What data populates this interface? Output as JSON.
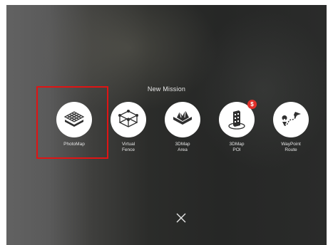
{
  "screen": {
    "title": "New Mission"
  },
  "missions": [
    {
      "label": "PhotoMap",
      "icon": "photomap-icon",
      "selected": true
    },
    {
      "label": "Virtual\nFence",
      "icon": "virtual-fence-icon"
    },
    {
      "label": "3DMap\nArea",
      "icon": "3dmap-area-icon"
    },
    {
      "label": "3DMap\nPOI",
      "icon": "3dmap-poi-icon",
      "badge": "$"
    },
    {
      "label": "WayPoint\nRoute",
      "icon": "waypoint-route-icon"
    }
  ],
  "close": {
    "icon": "close-icon"
  },
  "colors": {
    "highlight": "#e01414",
    "badge": "#e0302a",
    "icon": "#2f2f2f"
  }
}
